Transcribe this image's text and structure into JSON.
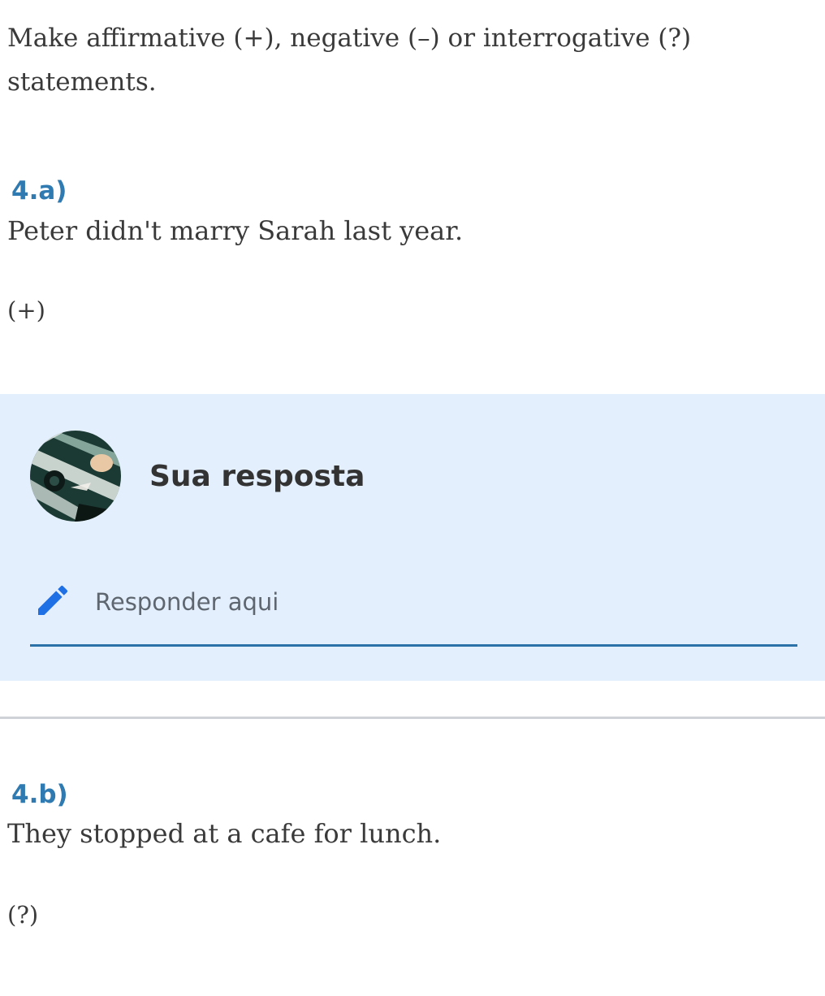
{
  "instructions": "Make affirmative (+), negative (–) or interrogative (?) statements.",
  "questions": [
    {
      "number": "4.a)",
      "sentence": "Peter didn't marry Sarah last year.",
      "mode": "(+)"
    },
    {
      "number": "4.b)",
      "sentence": "They stopped at a cafe for lunch.",
      "mode": "(?)"
    }
  ],
  "answer": {
    "title": "Sua resposta",
    "placeholder": "Responder aqui",
    "value": "",
    "avatar_icon": "user-avatar-cat-photo",
    "edit_icon": "pencil-icon"
  },
  "colors": {
    "accent": "#2f7ab0",
    "panel_bg": "#e4effd",
    "underline": "#2a72a8",
    "pencil": "#1f6fe5",
    "divider": "#cfd3d8",
    "body_text": "#3a3a3a"
  }
}
